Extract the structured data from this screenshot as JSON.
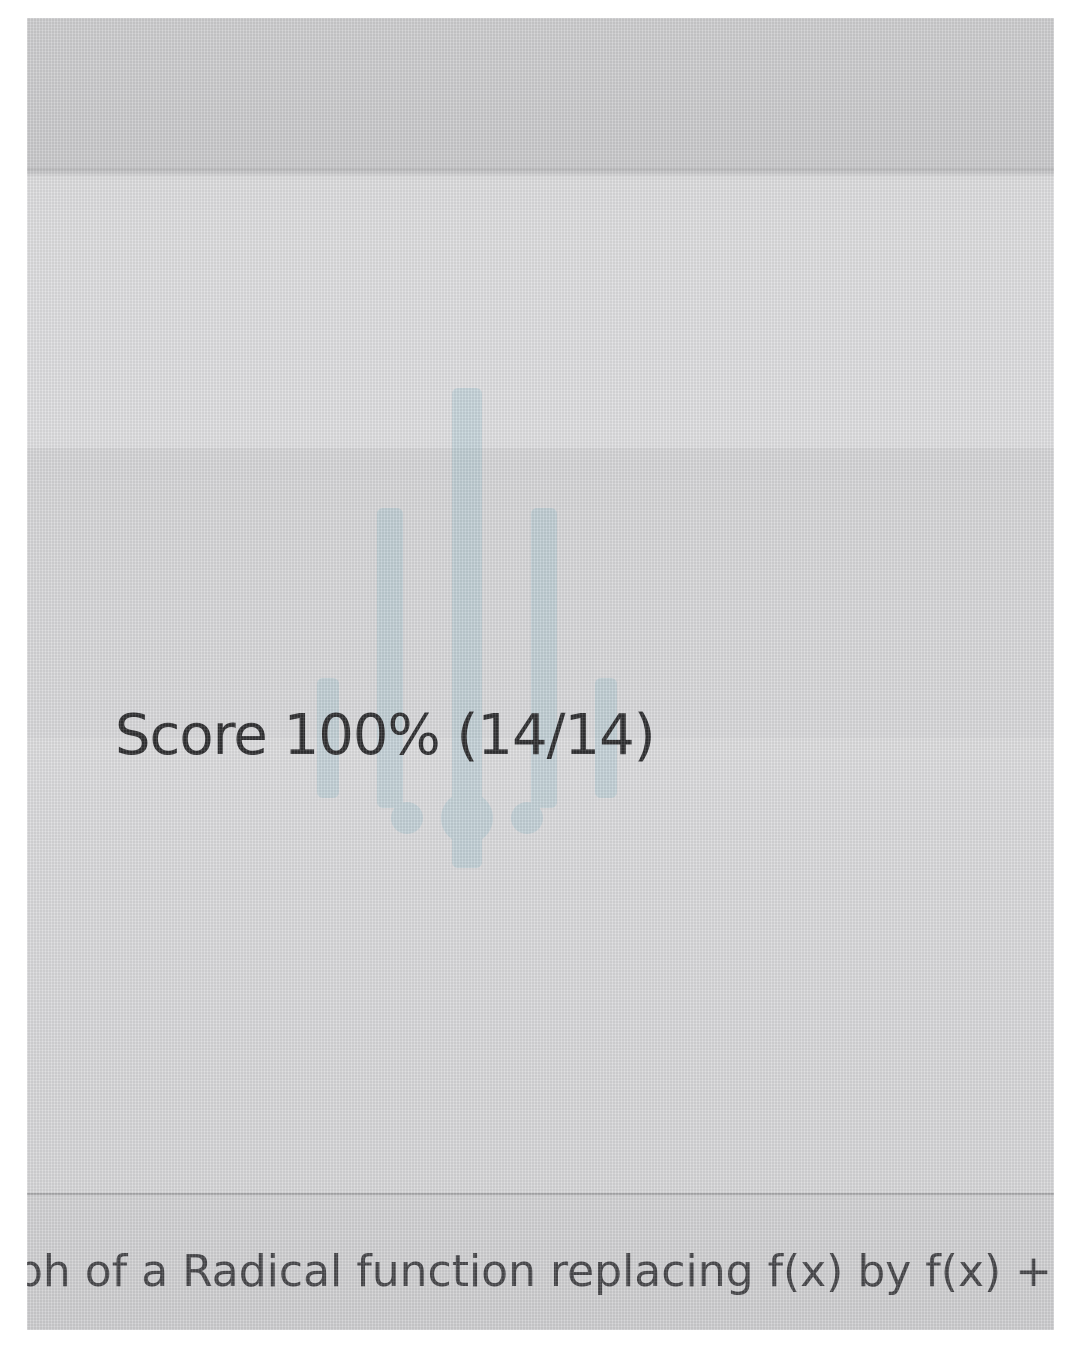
{
  "score": {
    "text": "Score 100% (14/14)",
    "percent": 100,
    "correct": 14,
    "total": 14
  },
  "question": {
    "title": "ph of a Radical function replacing f(x) by f(x) + k"
  },
  "colors": {
    "text_dark": "#303032",
    "text_secondary": "#47474a",
    "watermark": "#7fb6c8",
    "background": "#dedee0"
  }
}
